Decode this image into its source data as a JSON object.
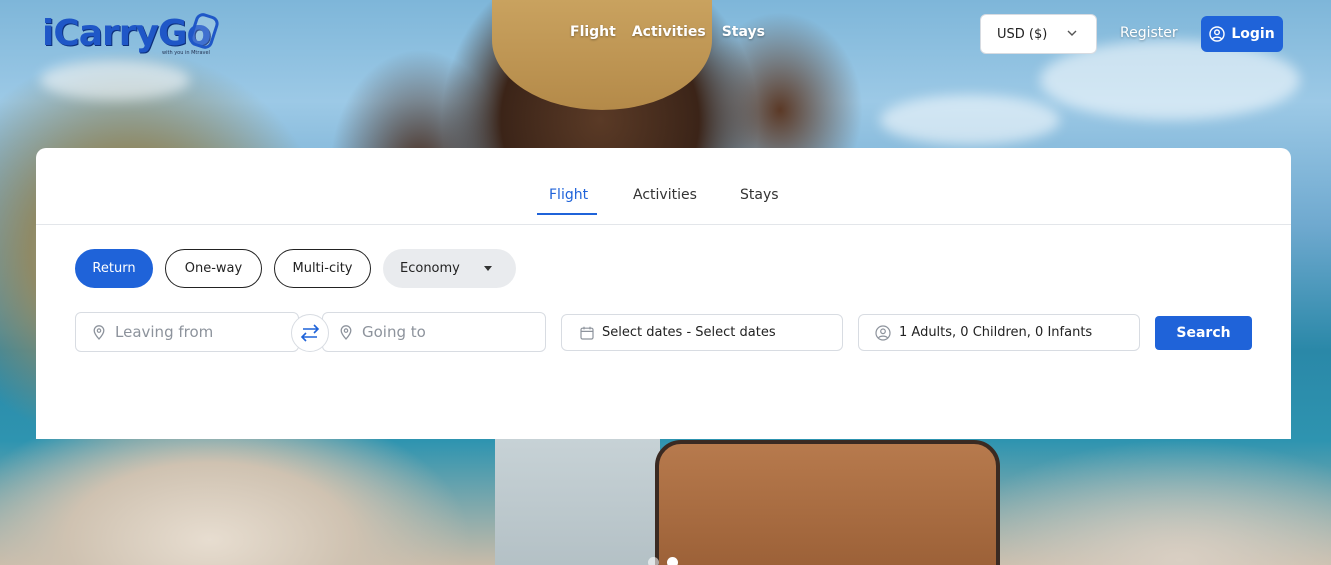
{
  "brand": {
    "name": "iCarryGo",
    "tagline": "with you in Mtravel",
    "color": "#1f57c7"
  },
  "top_nav": {
    "items": [
      "Flight",
      "Activities",
      "Stays"
    ]
  },
  "header": {
    "currency": "USD ($)",
    "register_label": "Register",
    "login_label": "Login"
  },
  "search_card": {
    "tabs": [
      {
        "label": "Flight",
        "active": true
      },
      {
        "label": "Activities",
        "active": false
      },
      {
        "label": "Stays",
        "active": false
      }
    ],
    "trip_types": [
      {
        "label": "Return",
        "active": true
      },
      {
        "label": "One-way",
        "active": false
      },
      {
        "label": "Multi-city",
        "active": false
      }
    ],
    "cabin_class": "Economy",
    "leaving_from_placeholder": "Leaving from",
    "going_to_placeholder": "Going to",
    "dates_value": "Select dates - Select dates",
    "passengers_value": "1 Adults, 0 Children, 0 Infants",
    "search_label": "Search"
  },
  "carousel": {
    "count": 2,
    "active_index": 1
  },
  "colors": {
    "primary": "#1f63d9",
    "border": "#d8dce2"
  }
}
